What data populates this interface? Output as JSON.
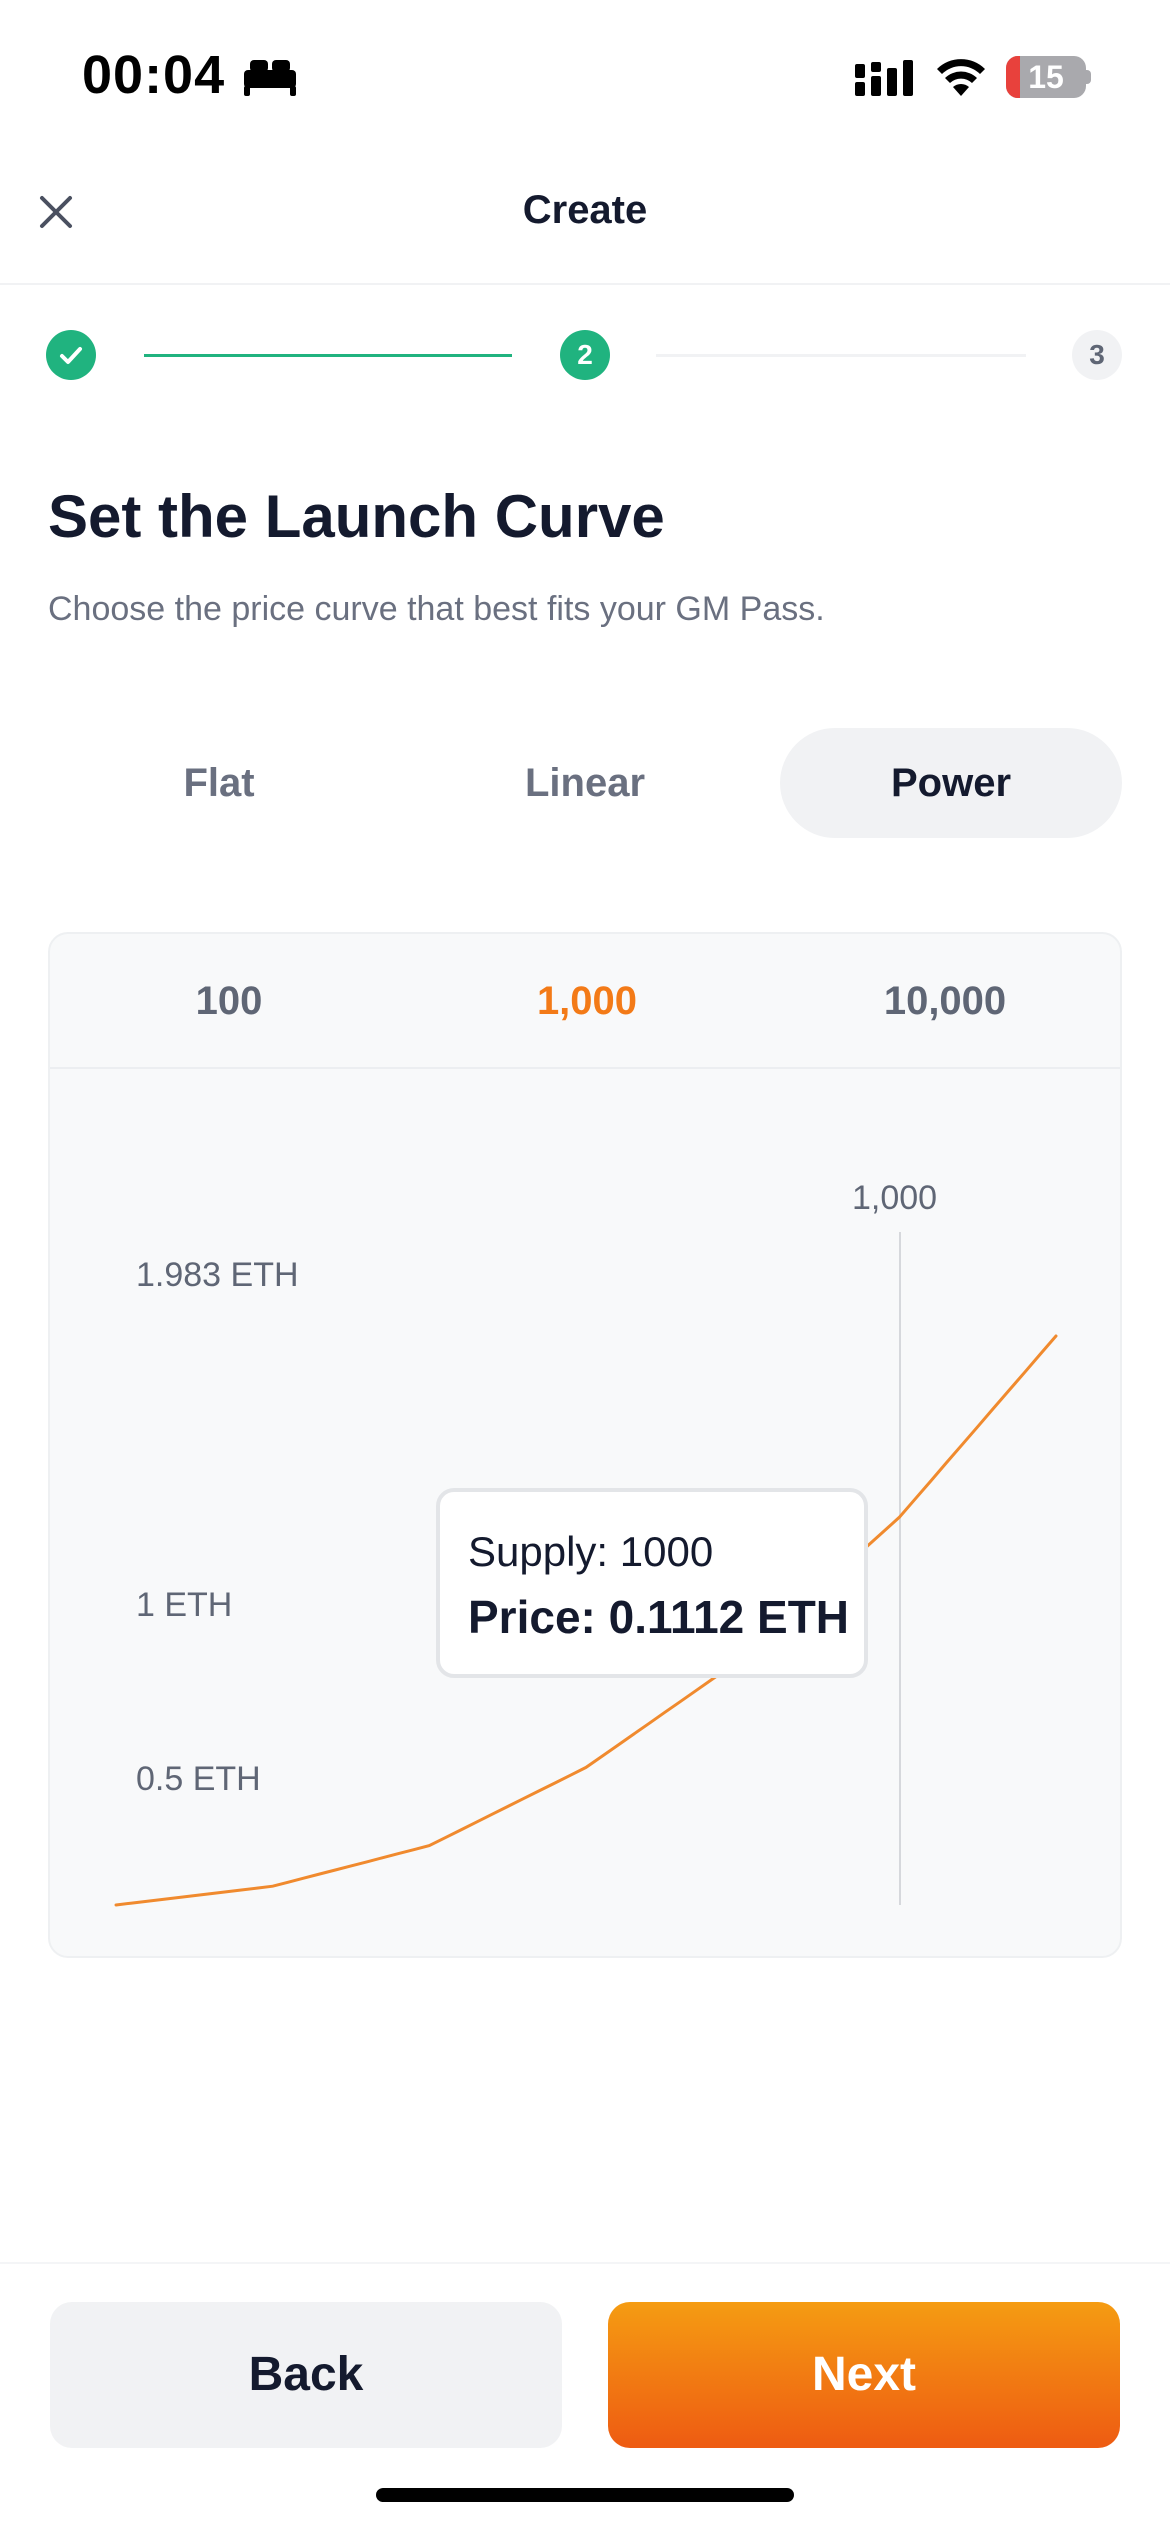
{
  "status_bar": {
    "time": "00:04",
    "battery_level": "15",
    "icons": [
      "bed-icon",
      "signal-icon",
      "wifi-icon",
      "battery-icon"
    ]
  },
  "header": {
    "title": "Create",
    "close_icon": "close-icon"
  },
  "stepper": {
    "steps": [
      {
        "label": "",
        "state": "completed",
        "icon": "check-icon"
      },
      {
        "label": "2",
        "state": "current"
      },
      {
        "label": "3",
        "state": "upcoming"
      }
    ],
    "completed_color": "#20b37f"
  },
  "content": {
    "title": "Set the Launch Curve",
    "subtitle": "Choose the price curve that best fits your GM Pass."
  },
  "curve_tabs": [
    {
      "label": "Flat",
      "active": false
    },
    {
      "label": "Linear",
      "active": false
    },
    {
      "label": "Power",
      "active": true
    }
  ],
  "supply_tabs": [
    {
      "label": "100",
      "active": false
    },
    {
      "label": "1,000",
      "active": true
    },
    {
      "label": "10,000",
      "active": false
    }
  ],
  "chart": {
    "y_labels": [
      "1.983 ETH",
      "1 ETH",
      "0.5 ETH"
    ],
    "marker_label": "1,000",
    "tooltip": {
      "supply": "Supply: 1000",
      "price": "Price: 0.1112 ETH"
    },
    "line_color": "#f08a2e",
    "accent_color": "#f37a17"
  },
  "chart_data": {
    "type": "line",
    "series": [
      {
        "x": [
          0,
          200,
          400,
          600,
          800,
          1000,
          1200
        ],
        "y": [
          0.0,
          0.06,
          0.19,
          0.44,
          0.79,
          1.24,
          1.82
        ]
      }
    ],
    "y_tick_labels": [
      "1.983 ETH",
      "1 ETH",
      "0.5 ETH"
    ],
    "marker": {
      "x": 1000,
      "label": "1,000"
    },
    "tooltip": {
      "supply": 1000,
      "price_eth": 0.1112
    },
    "grid": false
  },
  "footer": {
    "back_label": "Back",
    "next_label": "Next",
    "next_gradient": [
      "#f59c12",
      "#ee5b12"
    ]
  }
}
